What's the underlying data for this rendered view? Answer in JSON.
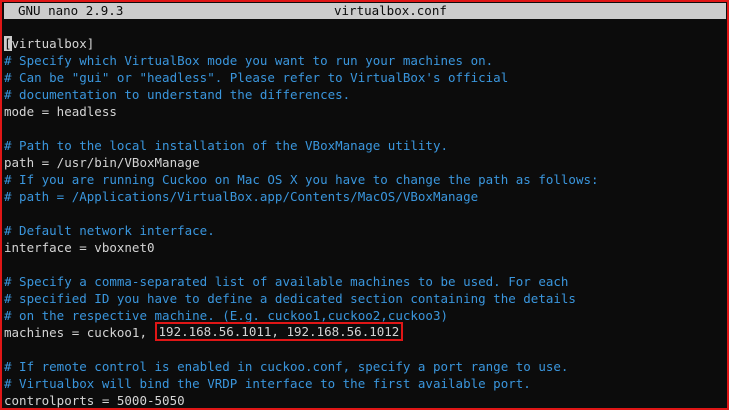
{
  "window": {
    "app_title": "GNU nano 2.9.3",
    "file_name": "virtualbox.conf"
  },
  "colors": {
    "comment": "#3a96dd",
    "text": "#d4d4d4",
    "highlight_border": "#e01616",
    "titlebar_bg": "#cccccc"
  },
  "lines": [
    {
      "type": "section",
      "cursor_char": "[",
      "text": "virtualbox]"
    },
    {
      "type": "comment",
      "text": "# Specify which VirtualBox mode you want to run your machines on."
    },
    {
      "type": "comment",
      "text": "# Can be \"gui\" or \"headless\". Please refer to VirtualBox's official"
    },
    {
      "type": "comment",
      "text": "# documentation to understand the differences."
    },
    {
      "type": "setting",
      "text": "mode = headless"
    },
    {
      "type": "blank",
      "text": ""
    },
    {
      "type": "comment",
      "text": "# Path to the local installation of the VBoxManage utility."
    },
    {
      "type": "setting",
      "text": "path = /usr/bin/VBoxManage"
    },
    {
      "type": "comment",
      "text": "# If you are running Cuckoo on Mac OS X you have to change the path as follows:"
    },
    {
      "type": "comment",
      "text": "# path = /Applications/VirtualBox.app/Contents/MacOS/VBoxManage"
    },
    {
      "type": "blank",
      "text": ""
    },
    {
      "type": "comment",
      "text": "# Default network interface."
    },
    {
      "type": "setting",
      "text": "interface = vboxnet0"
    },
    {
      "type": "blank",
      "text": ""
    },
    {
      "type": "comment",
      "text": "# Specify a comma-separated list of available machines to be used. For each"
    },
    {
      "type": "comment",
      "text": "# specified ID you have to define a dedicated section containing the details"
    },
    {
      "type": "comment",
      "text": "# on the respective machine. (E.g. cuckoo1,cuckoo2,cuckoo3)"
    },
    {
      "type": "machines",
      "prefix": "machines = cuckoo1, ",
      "highlighted": "192.168.56.1011, 192.168.56.1012"
    },
    {
      "type": "blank",
      "text": ""
    },
    {
      "type": "comment",
      "text": "# If remote control is enabled in cuckoo.conf, specify a port range to use."
    },
    {
      "type": "comment",
      "text": "# Virtualbox will bind the VRDP interface to the first available port."
    },
    {
      "type": "setting",
      "text": "controlports = 5000-5050"
    }
  ]
}
